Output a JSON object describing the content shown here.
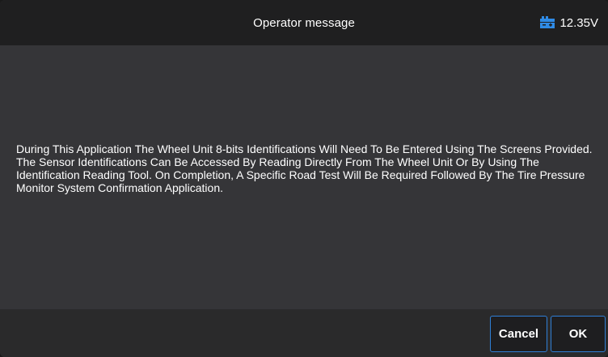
{
  "header": {
    "title": "Operator message",
    "battery_icon": "car-battery-icon",
    "voltage": "12.35V"
  },
  "message": {
    "text": "During This Application The Wheel Unit 8-bits Identifications Will Need To Be Entered Using The Screens Provided. The Sensor Identifications Can Be Accessed By Reading Directly From The Wheel Unit Or By Using The Identification Reading Tool. On Completion, A Specific Road Test Will Be Required Followed By The Tire Pressure Monitor System Confirmation Application."
  },
  "footer": {
    "cancel_label": "Cancel",
    "ok_label": "OK"
  },
  "colors": {
    "accent": "#2f7fd6",
    "header_bg": "#1f1f20",
    "content_bg": "#353538",
    "footer_bg": "#2a2a2b"
  }
}
